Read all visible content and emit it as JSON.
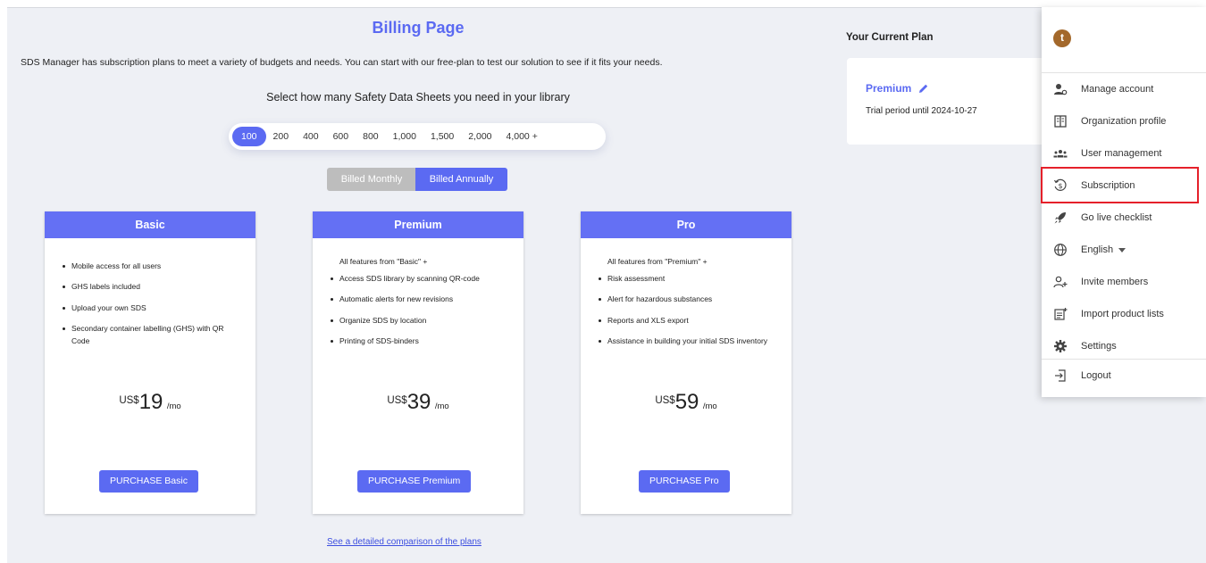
{
  "page": {
    "title": "Billing Page",
    "intro": "SDS Manager has subscription plans to meet a variety of budgets and needs. You can start with our free-plan to test our solution to see if it fits your needs.",
    "select_heading": "Select how many Safety Data Sheets you need in your library"
  },
  "quantities": [
    "100",
    "200",
    "400",
    "600",
    "800",
    "1,000",
    "1,500",
    "2,000",
    "4,000 +"
  ],
  "selected_quantity": "100",
  "billing": {
    "monthly_label": "Billed Monthly",
    "annually_label": "Billed Annually",
    "selected": "Billed Annually"
  },
  "plans": [
    {
      "name": "Basic",
      "lead": "",
      "features": [
        "Mobile access for all users",
        "GHS labels included",
        "Upload your own SDS",
        "Secondary container labelling (GHS) with QR Code"
      ],
      "currency": "US$",
      "price": "19",
      "period": "/mo",
      "button": "PURCHASE Basic"
    },
    {
      "name": "Premium",
      "lead": "All features from \"Basic\" +",
      "features": [
        "Access SDS library by scanning QR-code",
        "Automatic alerts for new revisions",
        "Organize SDS by location",
        "Printing of SDS-binders"
      ],
      "currency": "US$",
      "price": "39",
      "period": "/mo",
      "button": "PURCHASE Premium"
    },
    {
      "name": "Pro",
      "lead": "All features from \"Premium\" +",
      "features": [
        "Risk assessment",
        "Alert for hazardous substances",
        "Reports and XLS export",
        "Assistance in building your initial SDS inventory"
      ],
      "currency": "US$",
      "price": "59",
      "period": "/mo",
      "button": "PURCHASE Pro"
    }
  ],
  "compare_link": "See a detailed comparison of the plans",
  "current_plan": {
    "label": "Your Current Plan",
    "name": "Premium",
    "trial": "Trial period until 2024-10-27"
  },
  "menu": {
    "avatar_initial": "t",
    "items": [
      {
        "label": "Manage account",
        "icon": "manage-account-icon"
      },
      {
        "label": "Organization profile",
        "icon": "organization-icon"
      },
      {
        "label": "User management",
        "icon": "users-icon"
      },
      {
        "label": "Subscription",
        "icon": "subscription-icon"
      },
      {
        "label": "Go live checklist",
        "icon": "rocket-icon"
      },
      {
        "label": "English",
        "icon": "globe-icon"
      },
      {
        "label": "Invite members",
        "icon": "invite-icon"
      },
      {
        "label": "Import product lists",
        "icon": "import-icon"
      },
      {
        "label": "Settings",
        "icon": "gear-icon"
      },
      {
        "label": "Logout",
        "icon": "logout-icon"
      }
    ]
  },
  "colors": {
    "accent": "#5b6af2",
    "highlight": "#e5202a",
    "avatar": "#a3682b"
  }
}
